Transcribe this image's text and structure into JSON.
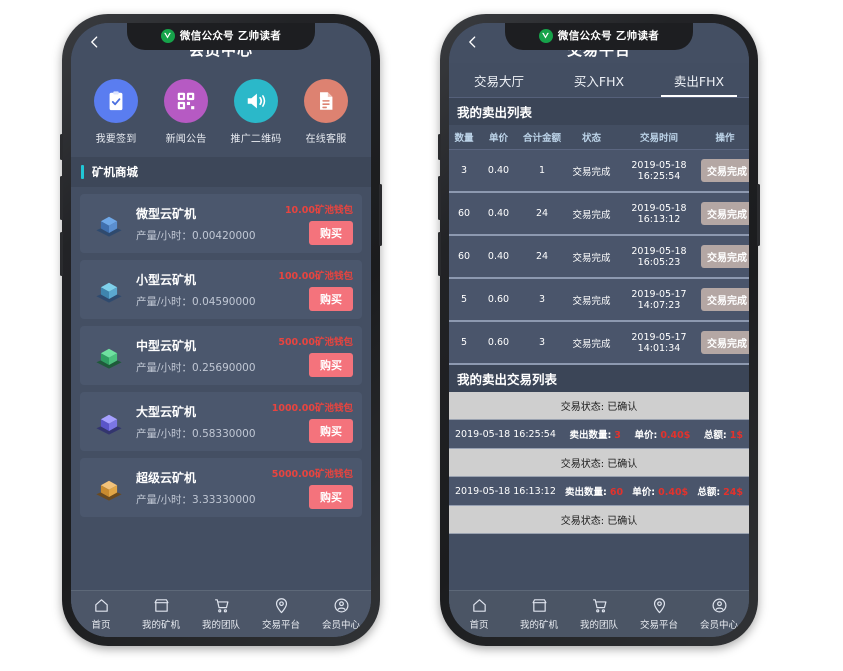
{
  "wechat_badge": {
    "logo": "v-logo-icon",
    "text": "微信公众号 乙帅读者"
  },
  "phone_left": {
    "title": "会员中心",
    "back_icon": "chevron-left-icon",
    "quick_actions": [
      {
        "label": "我要签到",
        "icon": "clipboard-check-icon",
        "color": "#5a7df0"
      },
      {
        "label": "新闻公告",
        "icon": "qrcode-icon",
        "color": "#b martin"
      },
      {
        "label": "推广二维码",
        "icon": "speaker-icon",
        "color": "#2bb8c9"
      },
      {
        "label": "在线客服",
        "icon": "document-icon",
        "color": "#dd8271"
      }
    ],
    "quick_colors": [
      "#5a7df0",
      "#b65ac3",
      "#2bb8c9",
      "#dd8271"
    ],
    "section": {
      "title": "矿机商城",
      "accent": "#21c7d6"
    },
    "miners": [
      {
        "name": "微型云矿机",
        "rate_label": "产量/小时：",
        "rate": "0.00420000",
        "price": "10.00矿池钱包",
        "buy": "购买",
        "icon_color": "#4a7fd4",
        "icon": "cube-blue-icon"
      },
      {
        "name": "小型云矿机",
        "rate_label": "产量/小时：",
        "rate": "0.04590000",
        "price": "100.00矿池钱包",
        "buy": "购买",
        "icon_color": "#4fa8d8",
        "icon": "cube-lightblue-icon"
      },
      {
        "name": "中型云矿机",
        "rate_label": "产量/小时：",
        "rate": "0.25690000",
        "price": "500.00矿池钱包",
        "buy": "购买",
        "icon_color": "#3fb96a",
        "icon": "cube-green-icon"
      },
      {
        "name": "大型云矿机",
        "rate_label": "产量/小时：",
        "rate": "0.58330000",
        "price": "1000.00矿池钱包",
        "buy": "购买",
        "icon_color": "#7a74ee",
        "icon": "cube-purple-icon"
      },
      {
        "name": "超级云矿机",
        "rate_label": "产量/小时：",
        "rate": "3.33330000",
        "price": "5000.00矿池钱包",
        "buy": "购买",
        "icon_color": "#e0a046",
        "icon": "cube-orange-icon"
      }
    ]
  },
  "phone_right": {
    "title": "交易平台",
    "back_icon": "chevron-left-icon",
    "tabs": [
      {
        "label": "交易大厅",
        "active": false
      },
      {
        "label": "买入FHX",
        "active": false
      },
      {
        "label": "卖出FHX",
        "active": true
      }
    ],
    "sell_list": {
      "title": "我的卖出列表",
      "columns": [
        "数量",
        "单价",
        "合计金额",
        "状态",
        "交易时间",
        "操作"
      ],
      "rows": [
        {
          "qty": "3",
          "price": "0.40",
          "total": "1",
          "state": "交易完成",
          "time": "2019-05-18 16:25:54",
          "action": "交易完成"
        },
        {
          "qty": "60",
          "price": "0.40",
          "total": "24",
          "state": "交易完成",
          "time": "2019-05-18 16:13:12",
          "action": "交易完成"
        },
        {
          "qty": "60",
          "price": "0.40",
          "total": "24",
          "state": "交易完成",
          "time": "2019-05-18 16:05:23",
          "action": "交易完成"
        },
        {
          "qty": "5",
          "price": "0.60",
          "total": "3",
          "state": "交易完成",
          "time": "2019-05-17 14:07:23",
          "action": "交易完成"
        },
        {
          "qty": "5",
          "price": "0.60",
          "total": "3",
          "state": "交易完成",
          "time": "2019-05-17 14:01:34",
          "action": "交易完成"
        }
      ]
    },
    "tx_list": {
      "title": "我的卖出交易列表",
      "state_label": "交易状态: 已确认",
      "qty_label": "卖出数量:",
      "price_label": "单价:",
      "total_label": "总额:",
      "entries": [
        {
          "date": "2019-05-18 16:25:54",
          "qty": "3",
          "price": "0.40$",
          "total": "1$"
        },
        {
          "date": "2019-05-18 16:13:12",
          "qty": "60",
          "price": "0.40$",
          "total": "24$"
        }
      ]
    }
  },
  "tabbar": {
    "items": [
      {
        "label": "首页",
        "icon": "home-icon"
      },
      {
        "label": "我的矿机",
        "icon": "store-icon"
      },
      {
        "label": "我的团队",
        "icon": "cart-icon"
      },
      {
        "label": "交易平台",
        "icon": "location-pin-icon"
      },
      {
        "label": "会员中心",
        "icon": "user-circle-icon"
      }
    ]
  }
}
